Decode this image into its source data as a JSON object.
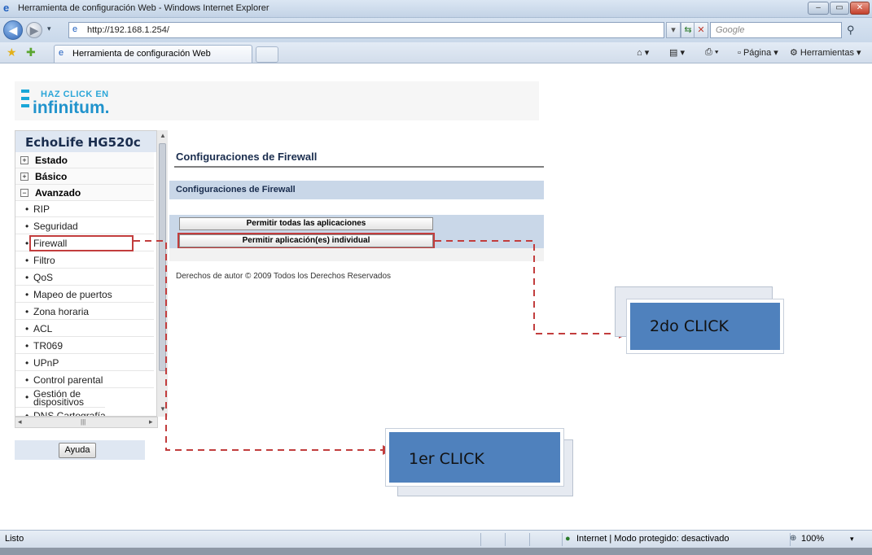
{
  "window": {
    "title": "Herramienta de configuración Web - Windows Internet Explorer",
    "url": "http://192.168.1.254/",
    "search_placeholder": "Google",
    "tab_label": "Herramienta de configuración Web",
    "command_pagina": "Página",
    "command_herramientas": "Herramientas",
    "status_text": "Listo",
    "zone_text": "Internet | Modo protegido: desactivado",
    "zoom_text": "100%"
  },
  "logo": {
    "line1": "HAZ CLICK EN",
    "line2": "infinitum."
  },
  "sidebar": {
    "device": "EchoLife HG520c",
    "main_items": [
      {
        "label": "Estado",
        "symbol": "+"
      },
      {
        "label": "Básico",
        "symbol": "+"
      },
      {
        "label": "Avanzado",
        "symbol": "−"
      }
    ],
    "sub_items": [
      "RIP",
      "Seguridad",
      "Firewall",
      "Filtro",
      "QoS",
      "Mapeo de puertos",
      "Zona horaria",
      "ACL",
      "TR069",
      "UPnP",
      "Control parental",
      "Gestión de dispositivos",
      "DNS Cartografía"
    ],
    "help_button": "Ayuda"
  },
  "content": {
    "title": "Configuraciones de Firewall",
    "panel_title": "Configuraciones de Firewall",
    "button_all": "Permitir todas las aplicaciones",
    "button_individual": "Permitir aplicación(es) individual",
    "copyright": "Derechos de autor © 2009 Todos los Derechos Reservados"
  },
  "annotations": {
    "first_click": "1er CLICK",
    "second_click": "2do CLICK",
    "highlight_color": "#c23d3d",
    "callout_color": "#4f81bd"
  }
}
